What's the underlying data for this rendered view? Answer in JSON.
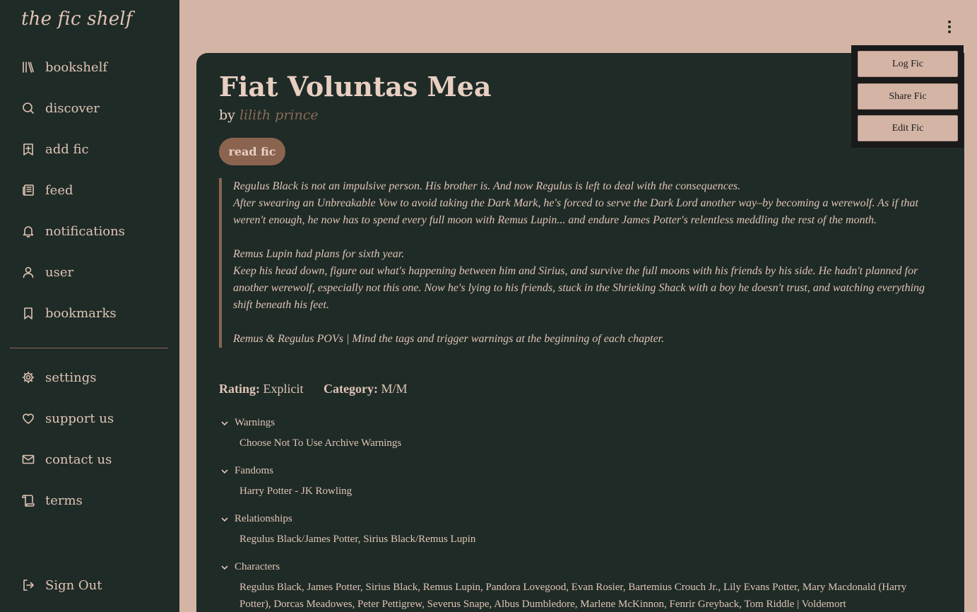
{
  "app": {
    "logo": "the fic shelf"
  },
  "sidebar": {
    "items": [
      {
        "label": "bookshelf",
        "icon": "books-icon"
      },
      {
        "label": "discover",
        "icon": "search-icon"
      },
      {
        "label": "add fic",
        "icon": "bookmark-plus-icon"
      },
      {
        "label": "feed",
        "icon": "newspaper-icon"
      },
      {
        "label": "notifications",
        "icon": "bell-icon"
      },
      {
        "label": "user",
        "icon": "user-icon"
      },
      {
        "label": "bookmarks",
        "icon": "bookmark-icon"
      }
    ],
    "secondary": [
      {
        "label": "settings",
        "icon": "gear-icon"
      },
      {
        "label": "support us",
        "icon": "heart-icon"
      },
      {
        "label": "contact us",
        "icon": "mail-icon"
      },
      {
        "label": "terms",
        "icon": "scroll-icon"
      }
    ],
    "signout": {
      "label": "Sign Out",
      "icon": "sign-out-icon"
    }
  },
  "fic": {
    "title": "Fiat Voluntas Mea",
    "by": "by",
    "author": "lilith prince",
    "read_label": "read fic",
    "summary": {
      "p1": "Regulus Black is not an impulsive person. His brother is. And now Regulus is left to deal with the consequences.",
      "p2": "After swearing an Unbreakable Vow to avoid taking the Dark Mark, he's forced to serve the Dark Lord another way–by becoming a werewolf. As if that weren't enough, he now has to spend every full moon with Remus Lupin... and endure James Potter's relentless meddling the rest of the month.",
      "p3": "Remus Lupin had plans for sixth year.",
      "p4": "Keep his head down, figure out what's happening between him and Sirius, and survive the full moons with his friends by his side. He hadn't planned for another werewolf, especially not this one. Now he's lying to his friends, stuck in the Shrieking Shack with a boy he doesn't trust, and watching everything shift beneath his feet.",
      "p5": "Remus & Regulus POVs | Mind the tags and trigger warnings at the beginning of each chapter."
    },
    "rating_label": "Rating:",
    "rating": "Explicit",
    "category_label": "Category:",
    "category": "M/M",
    "sections": {
      "warnings": {
        "label": "Warnings",
        "value": "Choose Not To Use Archive Warnings"
      },
      "fandoms": {
        "label": "Fandoms",
        "value": "Harry Potter - JK Rowling"
      },
      "relationships": {
        "label": "Relationships",
        "value": "Regulus Black/James Potter, Sirius Black/Remus Lupin"
      },
      "characters": {
        "label": "Characters",
        "value": "Regulus Black, James Potter, Sirius Black, Remus Lupin, Pandora Lovegood, Evan Rosier, Bartemius Crouch Jr., Lily Evans Potter, Mary Macdonald (Harry Potter), Dorcas Meadowes, Peter Pettigrew, Severus Snape, Albus Dumbledore, Marlene McKinnon, Fenrir Greyback, Tom Riddle | Voldemort"
      }
    }
  },
  "menu": {
    "log": "Log Fic",
    "share": "Share Fic",
    "edit": "Edit Fic"
  }
}
